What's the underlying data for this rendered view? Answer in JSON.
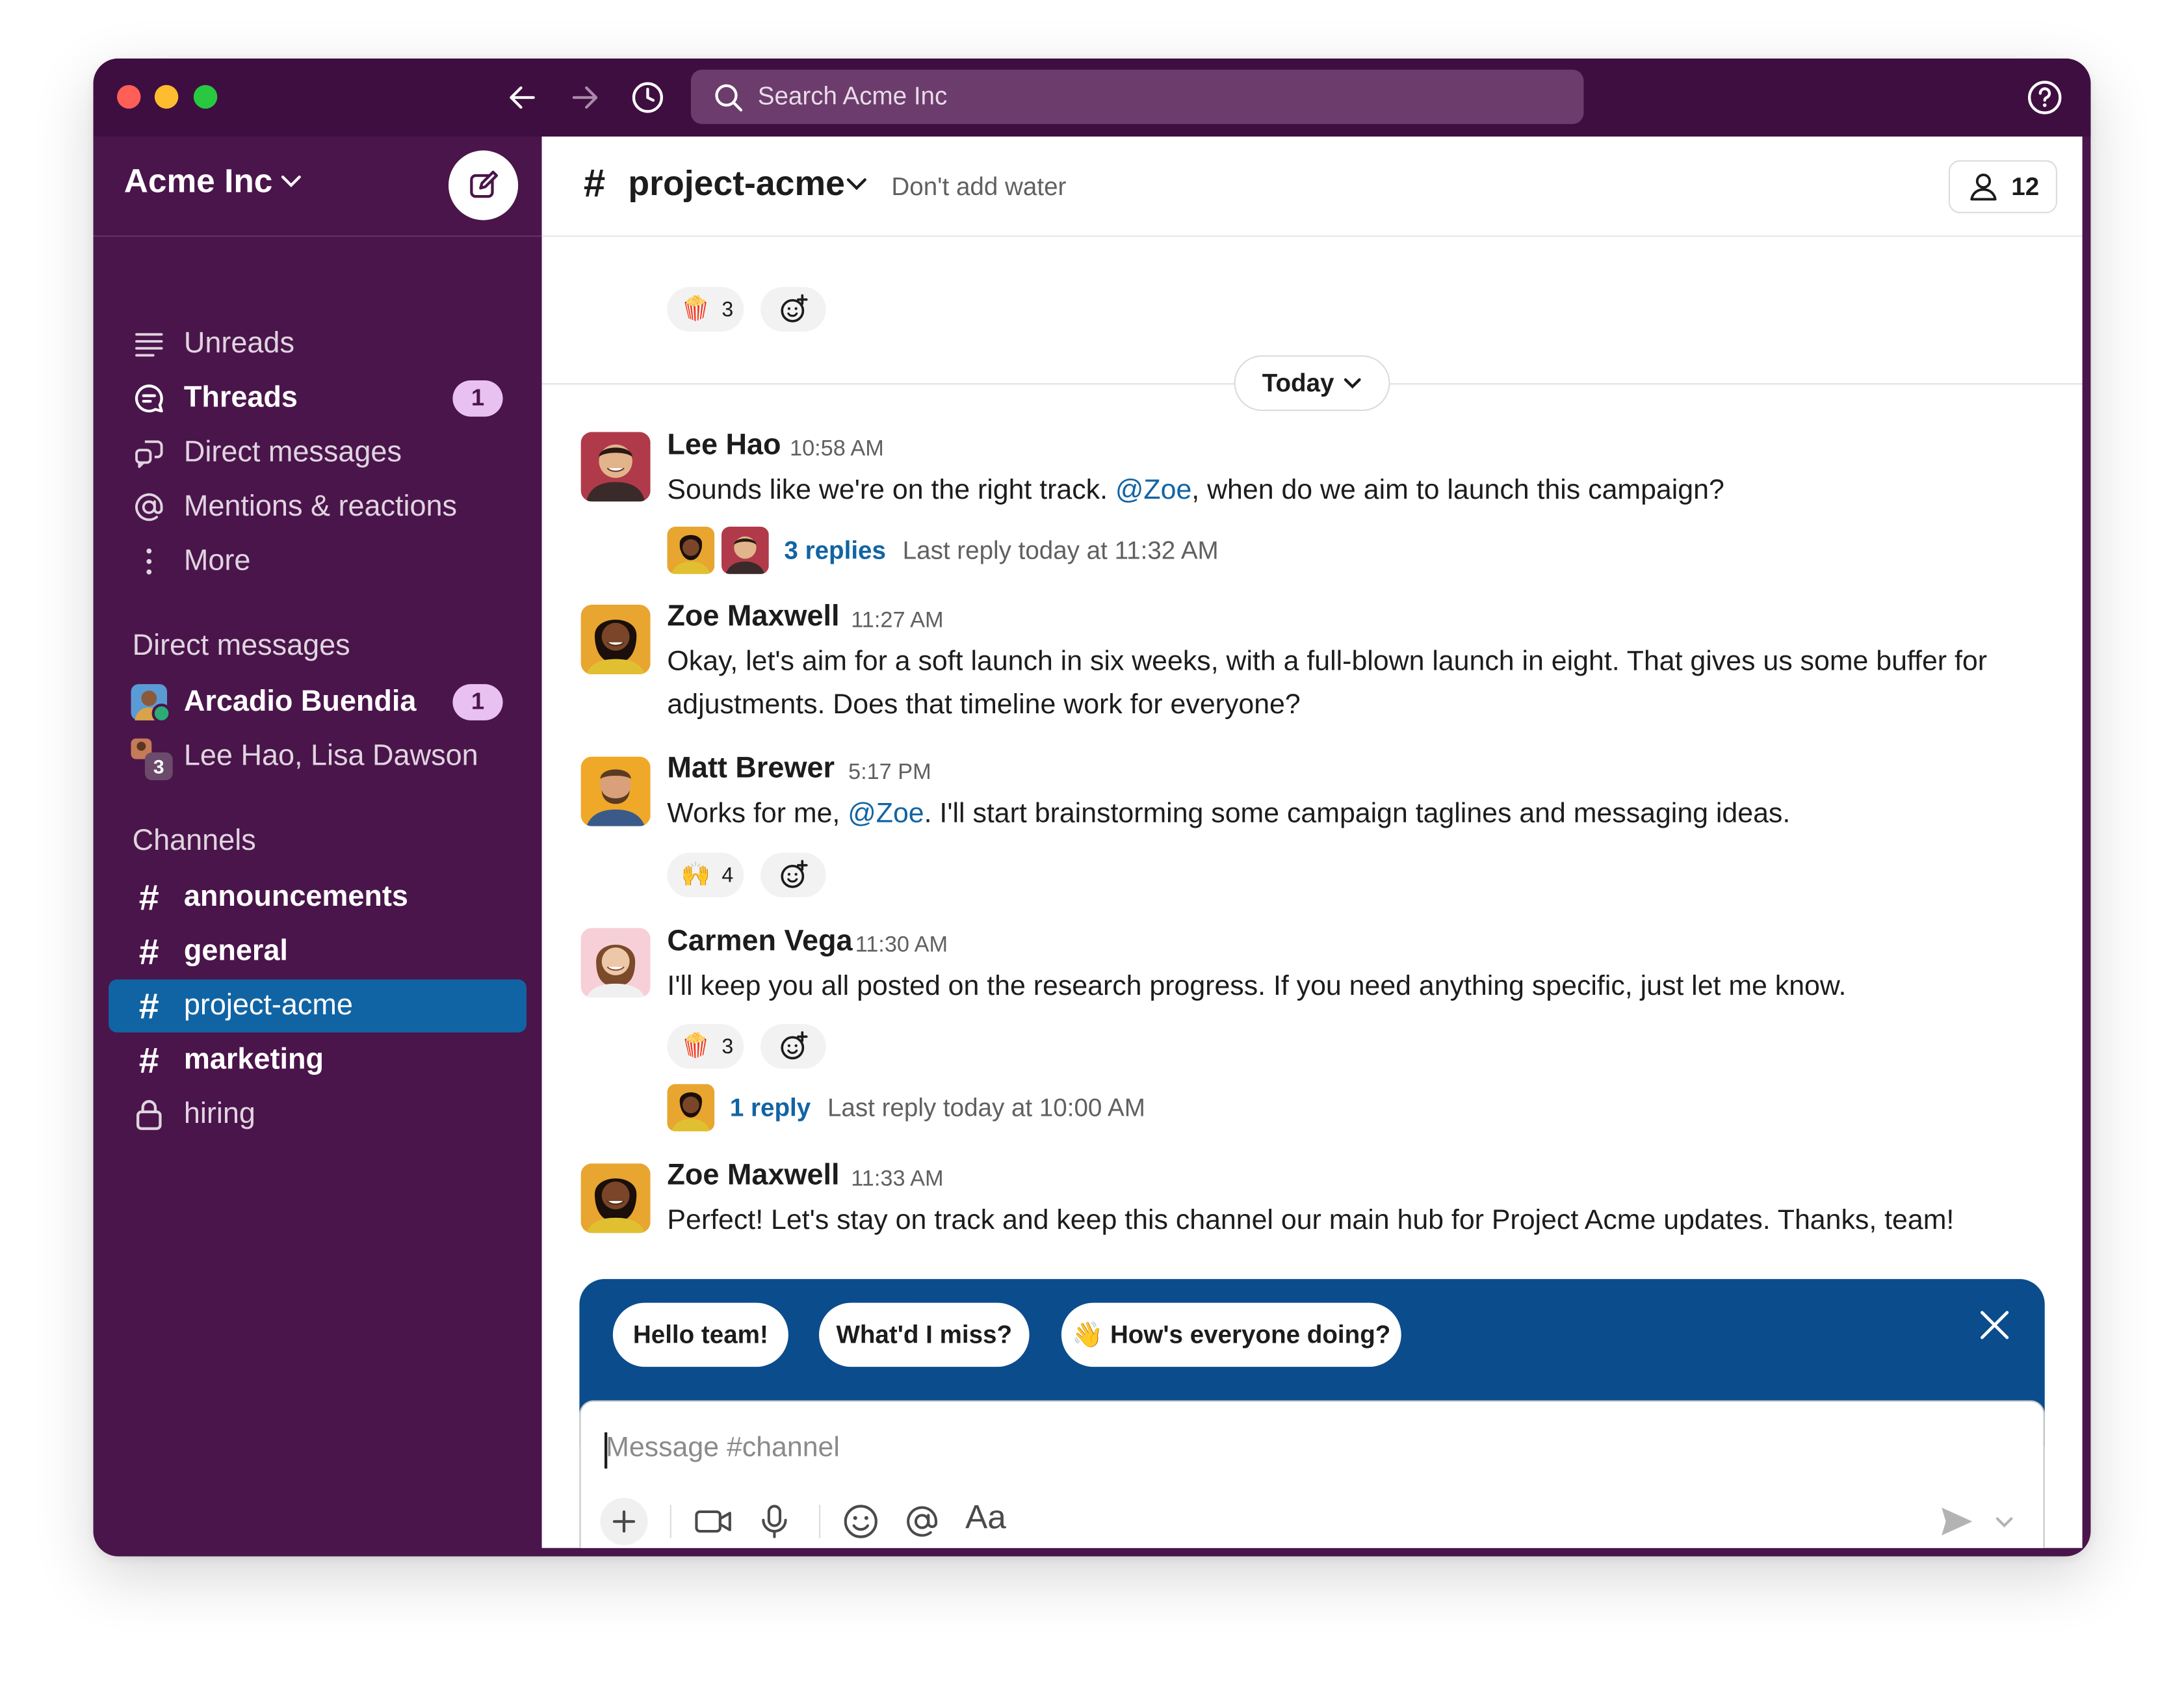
{
  "titlebar": {
    "search_placeholder": "Search Acme Inc",
    "icons": [
      "back-arrow-icon",
      "forward-arrow-icon",
      "history-clock-icon",
      "search-icon",
      "help-icon"
    ]
  },
  "sidebar": {
    "workspace": "Acme Inc",
    "nav": [
      {
        "label": "Unreads",
        "icon": "unreads-icon"
      },
      {
        "label": "Threads",
        "icon": "threads-icon",
        "badge": "1"
      },
      {
        "label": "Direct messages",
        "icon": "direct-messages-icon"
      },
      {
        "label": "Mentions & reactions",
        "icon": "at-icon"
      },
      {
        "label": "More",
        "icon": "more-vertical-icon"
      }
    ],
    "dm_section": "Direct messages",
    "dms": [
      {
        "label": "Arcadio Buendia",
        "badge": "1"
      },
      {
        "label": "Lee Hao, Lisa Dawson",
        "group_count": "3"
      }
    ],
    "channels_section": "Channels",
    "channels": [
      {
        "label": "announcements"
      },
      {
        "label": "general"
      },
      {
        "label": "project-acme"
      },
      {
        "label": "marketing"
      },
      {
        "label": "hiring",
        "private": true
      }
    ]
  },
  "channel": {
    "name": "project-acme",
    "topic": "Don't add water",
    "member_count": "12",
    "top_reaction": {
      "emoji": "🍿",
      "count": "3"
    },
    "date_divider": "Today"
  },
  "messages": [
    {
      "sender": "Lee Hao",
      "time": "10:58 AM",
      "text_before": "Sounds like we're on the right track. ",
      "mention": "@Zoe",
      "text_after": ", when do we aim to launch this campaign?",
      "replies": "3 replies",
      "last_reply": "Last reply today at 11:32 AM"
    },
    {
      "sender": "Zoe Maxwell",
      "time": "11:27 AM",
      "text": "Okay, let's aim for a soft launch in six weeks, with a full-blown launch in eight. That gives us some buffer for adjustments. Does that timeline work for everyone?"
    },
    {
      "sender": "Matt Brewer",
      "time": "5:17 PM",
      "text_before": "Works for me, ",
      "mention": "@Zoe",
      "text_after": ". I'll start brainstorming some campaign taglines and messaging ideas.",
      "reaction": {
        "emoji": "🙌",
        "count": "4"
      }
    },
    {
      "sender": "Carmen Vega",
      "time": "11:30 AM",
      "text": "I'll keep you all posted on the research progress. If you need anything specific, just let me know.",
      "reaction": {
        "emoji": "🍿",
        "count": "3"
      },
      "replies": "1 reply",
      "last_reply": "Last reply today at 10:00 AM"
    },
    {
      "sender": "Zoe Maxwell",
      "time": "11:33 AM",
      "text": "Perfect! Let's stay on track and keep this channel our main hub for Project Acme updates. Thanks, team!"
    }
  ],
  "suggestions": [
    "Hello team!",
    "What'd I miss?",
    "👋 How's everyone doing?"
  ],
  "composer": {
    "placeholder": "Message #channel",
    "format_label": "Aa"
  },
  "colors": {
    "sidebar": "#4a154b",
    "titlebar": "#3f0e40",
    "active_channel": "#1164a3",
    "suggestion_bar": "#0b4c8c",
    "link": "#1264a3",
    "badge": "#e9c1f0"
  }
}
